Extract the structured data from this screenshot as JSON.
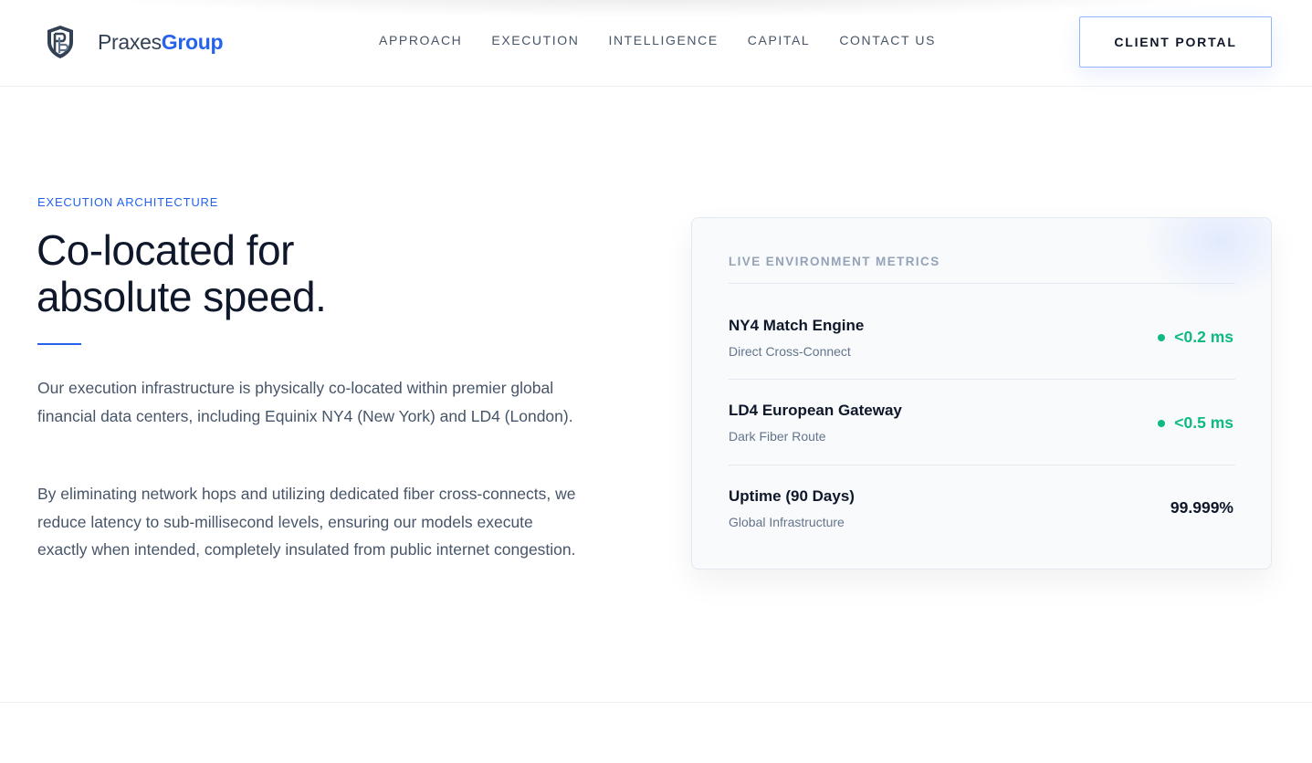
{
  "brand": {
    "name_part1": "Praxes",
    "name_part2": "Group",
    "accent_color": "#2563eb"
  },
  "nav": {
    "items": [
      "APPROACH",
      "EXECUTION",
      "INTELLIGENCE",
      "CAPITAL",
      "CONTACT US"
    ]
  },
  "header": {
    "portal_label": "CLIENT PORTAL"
  },
  "hero": {
    "eyebrow": "EXECUTION ARCHITECTURE",
    "headline_line1": "Co-located for",
    "headline_line2": "absolute speed.",
    "paragraph1": "Our execution infrastructure is physically co-located within premier global financial data centers, including Equinix NY4 (New York) and LD4 (London).",
    "paragraph2": "By eliminating network hops and utilizing dedicated fiber cross-connects, we reduce latency to sub-millisecond levels, ensuring our models execute exactly when intended, completely insulated from public internet congestion."
  },
  "metrics": {
    "title": "LIVE ENVIRONMENT METRICS",
    "status_color": "#10b981",
    "items": [
      {
        "name": "NY4 Match Engine",
        "sub": "Direct Cross-Connect",
        "value": "<0.2 ms",
        "status_icon": "status-dot-icon"
      },
      {
        "name": "LD4 European Gateway",
        "sub": "Dark Fiber Route",
        "value": "<0.5 ms",
        "status_icon": "status-dot-icon"
      },
      {
        "name": "Uptime (90 Days)",
        "sub": "Global Infrastructure",
        "value": "99.999%"
      }
    ]
  }
}
